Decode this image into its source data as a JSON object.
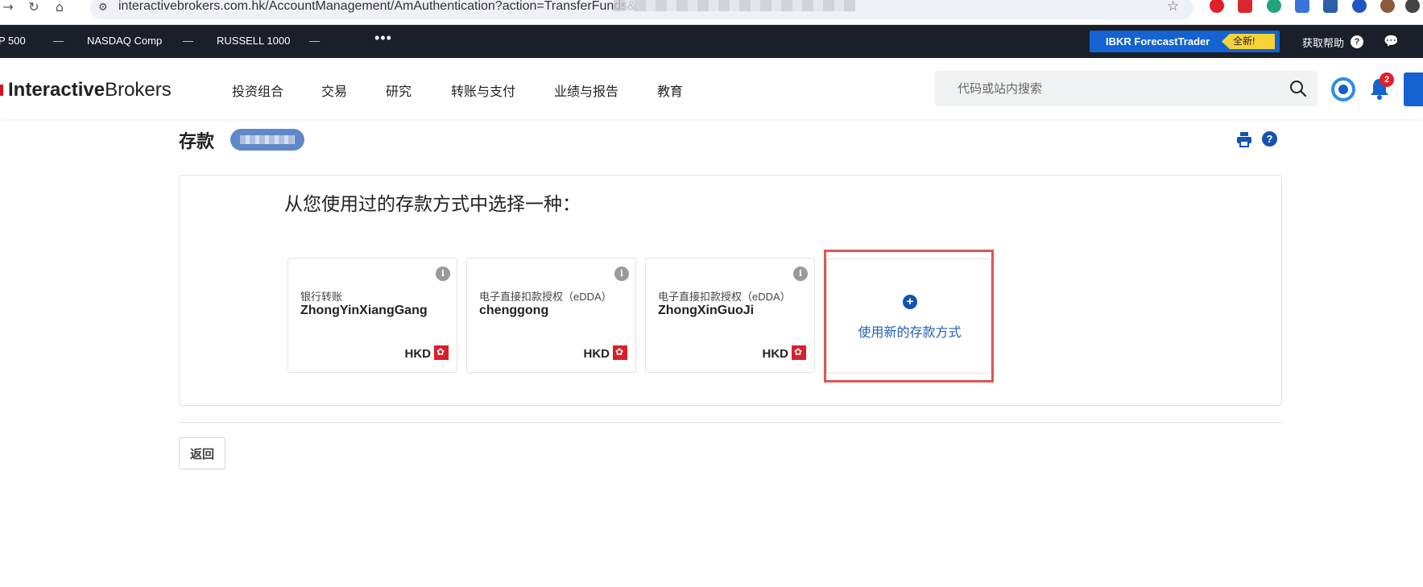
{
  "browser": {
    "back_glyph": "→",
    "reload_glyph": "↻",
    "home_glyph": "⌂",
    "url_icon_glyph": "⚙",
    "url": "interactivebrokers.com.hk/AccountManagement/AmAuthentication?action=TransferFunds&",
    "star_glyph": "☆",
    "extension_colors": [
      "#e0202b",
      "#d6282e",
      "#23a37a",
      "#3a74d8",
      "#2d5fa8",
      "#1f56c2",
      "#8a5a3c",
      "#444444"
    ]
  },
  "ticker": {
    "items": [
      {
        "label": "P 500",
        "value": "—"
      },
      {
        "label": "NASDAQ Comp",
        "value": "—"
      },
      {
        "label": "RUSSELL 1000",
        "value": "—"
      }
    ],
    "more_glyph": "•••",
    "forecast_label": "IBKR ForecastTrader",
    "new_badge": "全新!",
    "help_label": "获取帮助",
    "help_glyph": "?",
    "chat_glyph": "💬"
  },
  "header": {
    "logo_strong": "Interactive",
    "logo_light": "Brokers",
    "nav": [
      "投资组合",
      "交易",
      "研究",
      "转账与支付",
      "业绩与报告",
      "教育"
    ],
    "search_placeholder": "代码或站内搜索",
    "notification_count": "2"
  },
  "page": {
    "title": "存款",
    "help_glyph": "?",
    "heading": "从您使用过的存款方式中选择一种：",
    "methods": [
      {
        "type": "银行转账",
        "name": "ZhongYinXiangGang",
        "currency": "HKD"
      },
      {
        "type": "电子直接扣款授权（eDDA）",
        "name": "chenggong",
        "currency": "HKD"
      },
      {
        "type": "电子直接扣款授权（eDDA）",
        "name": "ZhongXinGuoJi",
        "currency": "HKD"
      }
    ],
    "info_glyph": "i",
    "plus_glyph": "+",
    "new_method_label": "使用新的存款方式",
    "back_label": "返回"
  },
  "colors": {
    "brand_red": "#d81222",
    "brand_blue": "#1463d0",
    "link_blue": "#1f5fb5",
    "highlight_border": "#e05555",
    "ticker_bg": "#1b1f2a"
  }
}
